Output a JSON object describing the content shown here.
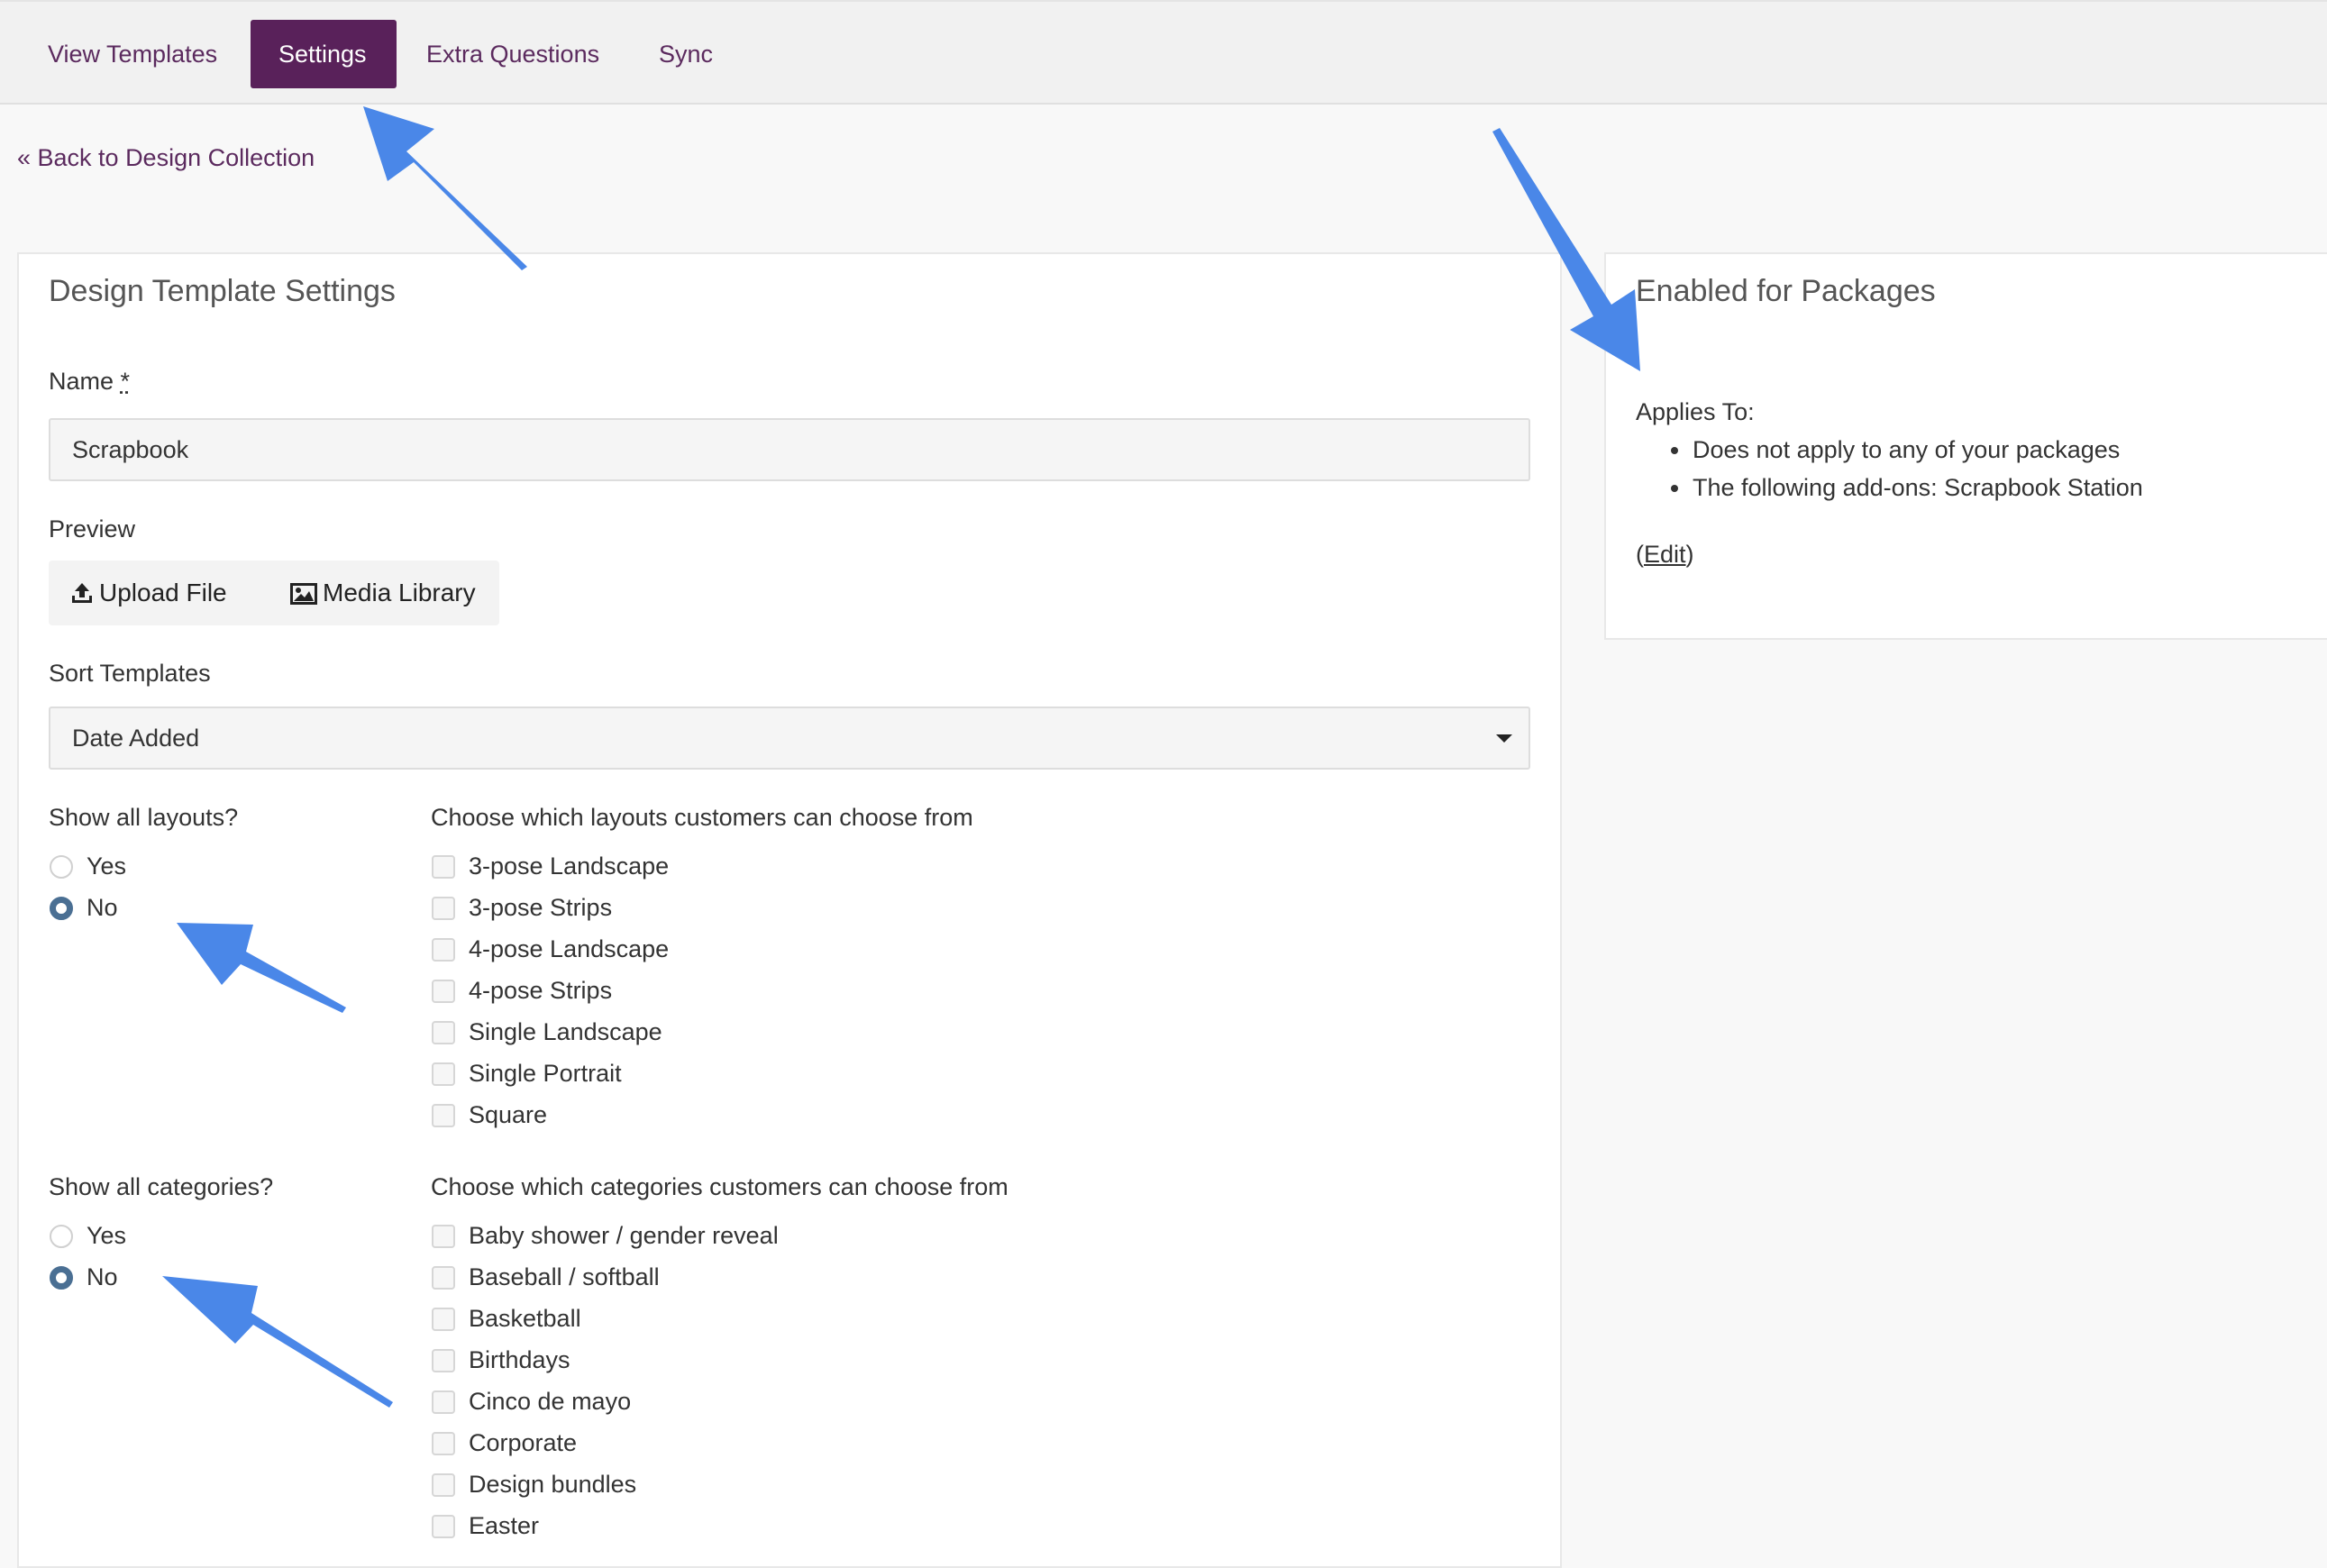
{
  "nav": {
    "tabs": [
      {
        "label": "View Templates"
      },
      {
        "label": "Settings"
      },
      {
        "label": "Extra Questions"
      },
      {
        "label": "Sync"
      }
    ]
  },
  "back_link": "« Back to Design Collection",
  "main_panel": {
    "title": "Design Template Settings",
    "name_label": "Name",
    "name_required": "*",
    "name_value": "Scrapbook",
    "preview_label": "Preview",
    "upload_button": "Upload File",
    "media_button": "Media Library",
    "sort_label": "Sort Templates",
    "sort_value": "Date Added",
    "layouts": {
      "question": "Show all layouts?",
      "yes": "Yes",
      "no": "No",
      "selected": "No",
      "choose_label": "Choose which layouts customers can choose from",
      "options": [
        "3-pose Landscape",
        "3-pose Strips",
        "4-pose Landscape",
        "4-pose Strips",
        "Single Landscape",
        "Single Portrait",
        "Square"
      ]
    },
    "categories": {
      "question": "Show all categories?",
      "yes": "Yes",
      "no": "No",
      "selected": "No",
      "choose_label": "Choose which categories customers can choose from",
      "options": [
        "Baby shower / gender reveal",
        "Baseball / softball",
        "Basketball",
        "Birthdays",
        "Cinco de mayo",
        "Corporate",
        "Design bundles",
        "Easter"
      ]
    }
  },
  "side_panel": {
    "title": "Enabled for Packages",
    "applies_label": "Applies To:",
    "items": [
      "Does not apply to any of your packages",
      "The following add-ons: Scrapbook Station"
    ],
    "edit_open": "(",
    "edit_link": "Edit",
    "edit_close": ")"
  },
  "colors": {
    "accent": "#59215a",
    "link": "#5b2a5e",
    "radio_checked": "#4a6f93",
    "annotation_arrow": "#4a87e8"
  },
  "icons": {
    "upload": "upload-icon",
    "media": "image-icon",
    "caret": "caret-down-icon"
  }
}
